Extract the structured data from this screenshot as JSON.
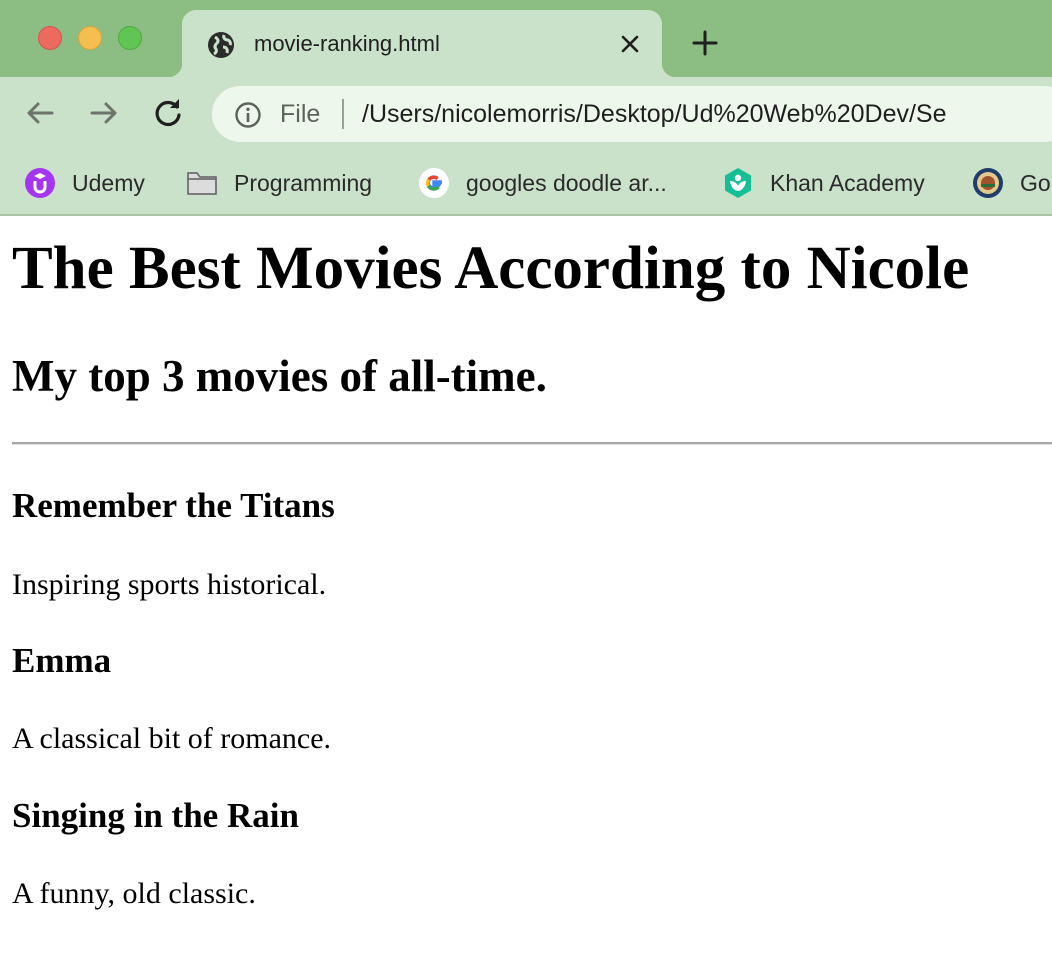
{
  "browser": {
    "tab": {
      "title": "movie-ranking.html",
      "icon": "globe-icon"
    },
    "address_bar": {
      "scheme_label": "File",
      "url": "/Users/nicolemorris/Desktop/Ud%20Web%20Dev/Se"
    },
    "bookmarks": [
      {
        "label": "Udemy",
        "icon": "udemy-icon",
        "color": "#a435f0"
      },
      {
        "label": "Programming",
        "icon": "folder-icon"
      },
      {
        "label": "googles doodle ar...",
        "icon": "google-icon"
      },
      {
        "label": "Khan Academy",
        "icon": "khan-academy-icon",
        "color": "#14bf96"
      },
      {
        "label": "Go",
        "icon": "seal-icon"
      }
    ],
    "colors": {
      "tabbar": "#8cbd82",
      "toolbar": "#cae2c9"
    }
  },
  "page": {
    "title": "The Best Movies According to Nicole",
    "subtitle": "My top 3 movies of all-time.",
    "movies": [
      {
        "name": "Remember the Titans",
        "description": "Inspiring sports historical."
      },
      {
        "name": "Emma",
        "description": "A classical bit of romance."
      },
      {
        "name": "Singing in the Rain",
        "description": "A funny, old classic."
      }
    ]
  }
}
